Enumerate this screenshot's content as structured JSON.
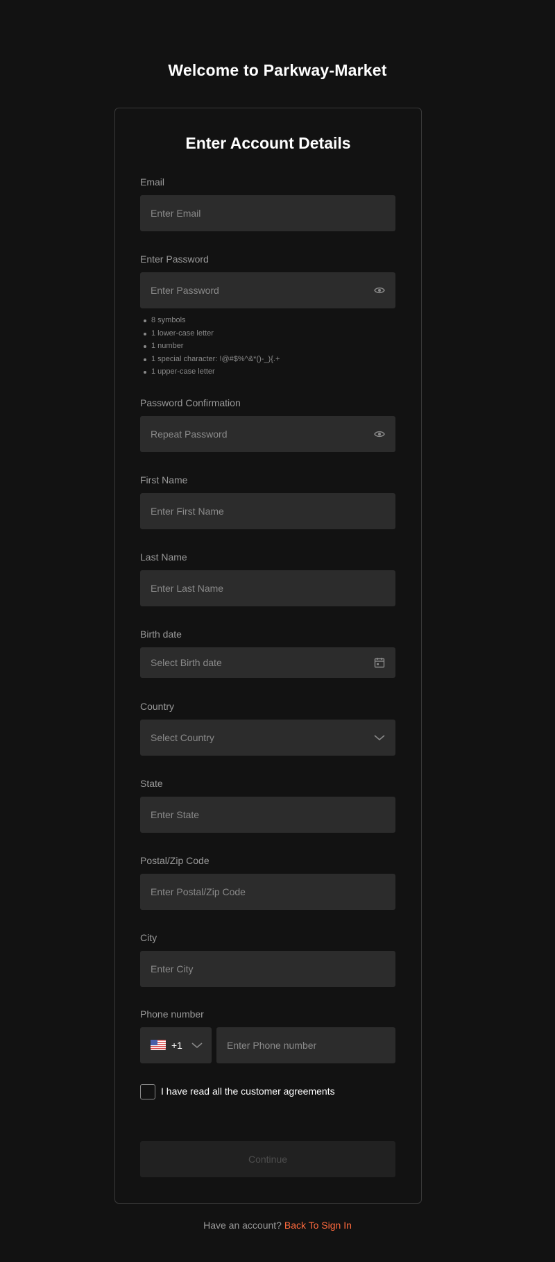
{
  "page": {
    "title": "Welcome to Parkway-Market"
  },
  "form": {
    "title": "Enter Account Details",
    "email": {
      "label": "Email",
      "placeholder": "Enter Email"
    },
    "password": {
      "label": "Enter Password",
      "placeholder": "Enter Password",
      "icon": "eye-icon",
      "rules": [
        "8 symbols",
        "1 lower-case letter",
        "1 number",
        "1 special character: !@#$%^&*()-_){.+",
        "1 upper-case letter"
      ]
    },
    "password_confirmation": {
      "label": "Password Confirmation",
      "placeholder": "Repeat Password",
      "icon": "eye-icon"
    },
    "first_name": {
      "label": "First Name",
      "placeholder": "Enter First Name"
    },
    "last_name": {
      "label": "Last Name",
      "placeholder": "Enter Last Name"
    },
    "birth_date": {
      "label": "Birth date",
      "placeholder": "Select Birth date",
      "icon": "calendar-icon"
    },
    "country": {
      "label": "Country",
      "placeholder": "Select Country",
      "icon": "chevron-down-icon"
    },
    "state": {
      "label": "State",
      "placeholder": "Enter State"
    },
    "postal_code": {
      "label": "Postal/Zip Code",
      "placeholder": "Enter Postal/Zip Code"
    },
    "city": {
      "label": "City",
      "placeholder": "Enter City"
    },
    "phone": {
      "label": "Phone number",
      "country_code": "+1",
      "flag": "us-flag-icon",
      "placeholder": "Enter Phone number"
    },
    "agreement": {
      "label": "I have read all the customer agreements",
      "checked": false
    },
    "continue_label": "Continue"
  },
  "footer": {
    "text": "Have an account?",
    "link": "Back To Sign In"
  },
  "colors": {
    "background": "#121212",
    "input_bg": "#2c2c2c",
    "link": "#ff6a3d",
    "disabled_button": "#212121"
  }
}
